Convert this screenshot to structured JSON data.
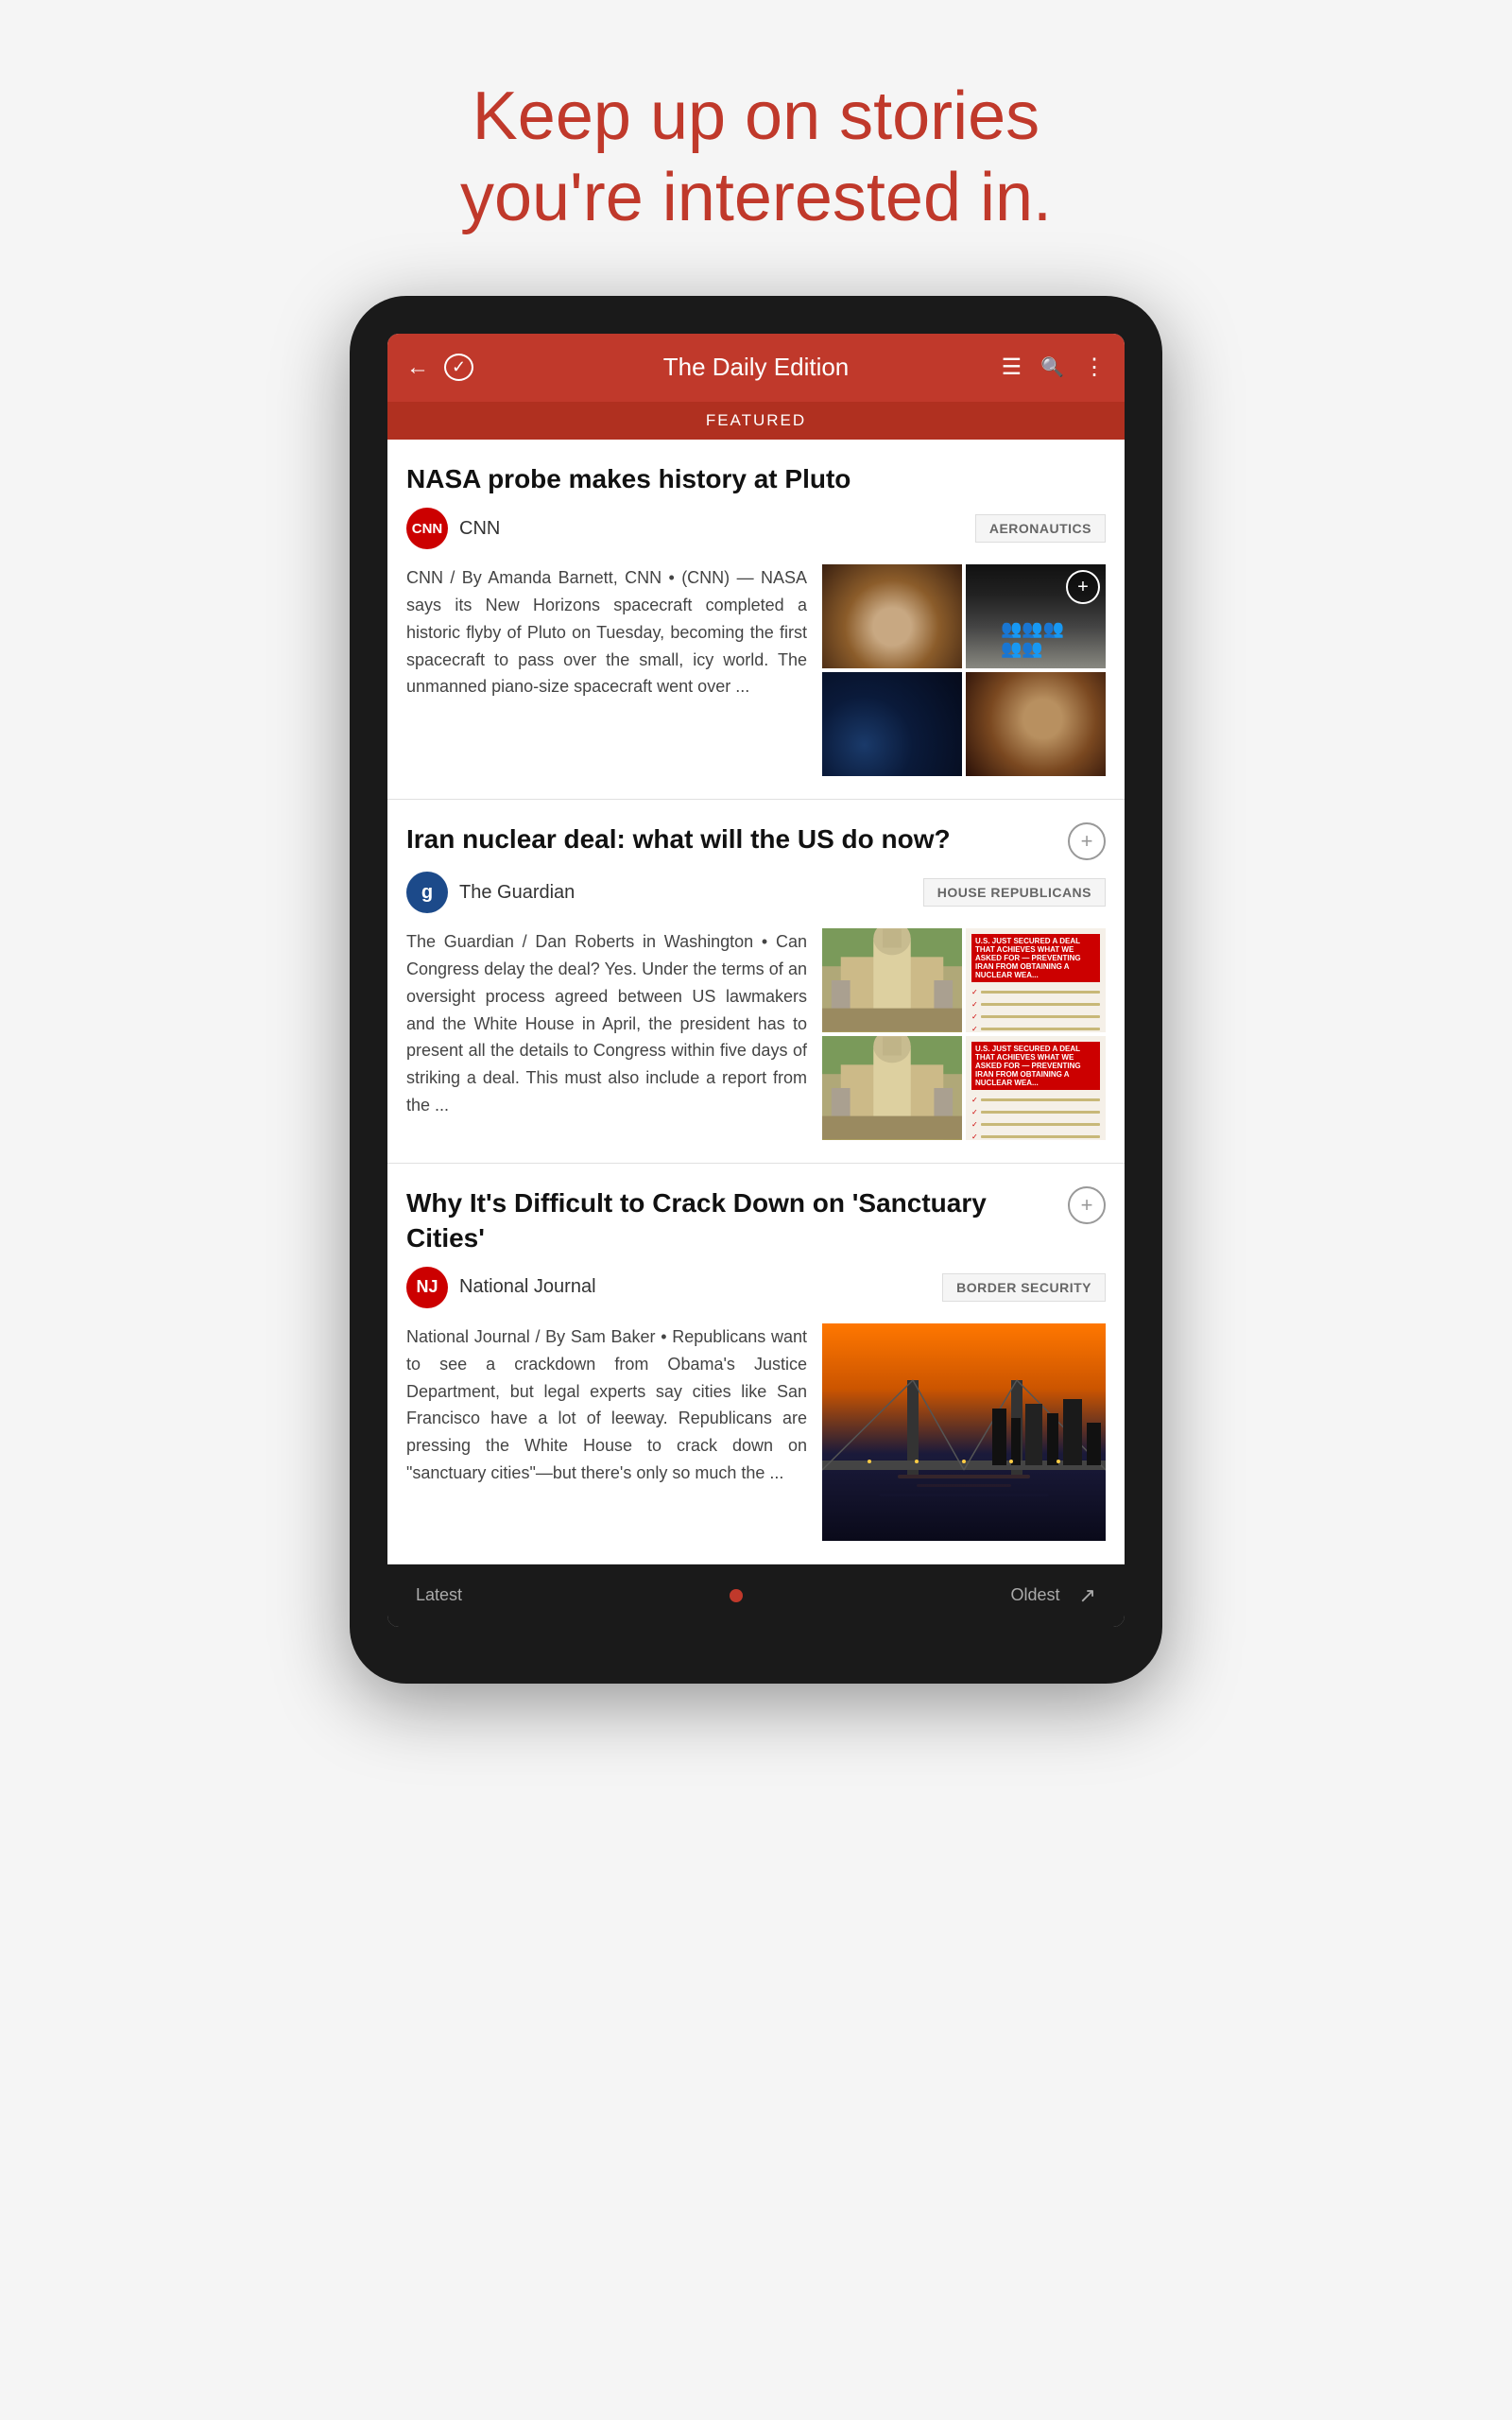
{
  "tagline": {
    "line1": "Keep up on stories",
    "line2": "you're interested in."
  },
  "header": {
    "title": "The Daily Edition",
    "featured_label": "FEATURED"
  },
  "articles": [
    {
      "id": "nasa",
      "title": "NASA probe makes history at Pluto",
      "source": "CNN",
      "source_type": "cnn",
      "category": "AERONAUTICS",
      "body": "CNN / By Amanda Barnett, CNN • (CNN) — NASA says its New Horizons spacecraft completed a historic flyby of Pluto on Tuesday, becoming the first spacecraft to pass over the small, icy world. The unmanned piano-size spacecraft went over ..."
    },
    {
      "id": "iran",
      "title": "Iran nuclear deal: what will the US do now?",
      "source": "The Guardian",
      "source_type": "guardian",
      "category": "HOUSE REPUBLICANS",
      "body": "The Guardian / Dan Roberts in Washington • Can Congress delay the deal? Yes. Under the terms of an oversight process agreed between US lawmakers and the White House in April, the president has to present all the details to Congress within five days of striking a deal. This must also include a report from the ..."
    },
    {
      "id": "sanctuary",
      "title": "Why It's Difficult to Crack Down on 'Sanctuary Cities'",
      "source": "National Journal",
      "source_type": "nj",
      "category": "BORDER SECURITY",
      "body": "National Journal / By Sam Baker • Republicans want to see a crackdown from Obama's Justice Department, but legal experts say cities like San Francisco have a lot of leeway. Republicans are pressing the White House to crack down on \"sanctuary cities\"—but there's only so much the ..."
    }
  ],
  "bottom_nav": {
    "latest": "Latest",
    "oldest": "Oldest"
  },
  "icons": {
    "back": "←",
    "check": "✓",
    "menu": "☰",
    "search": "🔍",
    "more": "⋮",
    "add": "+",
    "share": "↗"
  }
}
